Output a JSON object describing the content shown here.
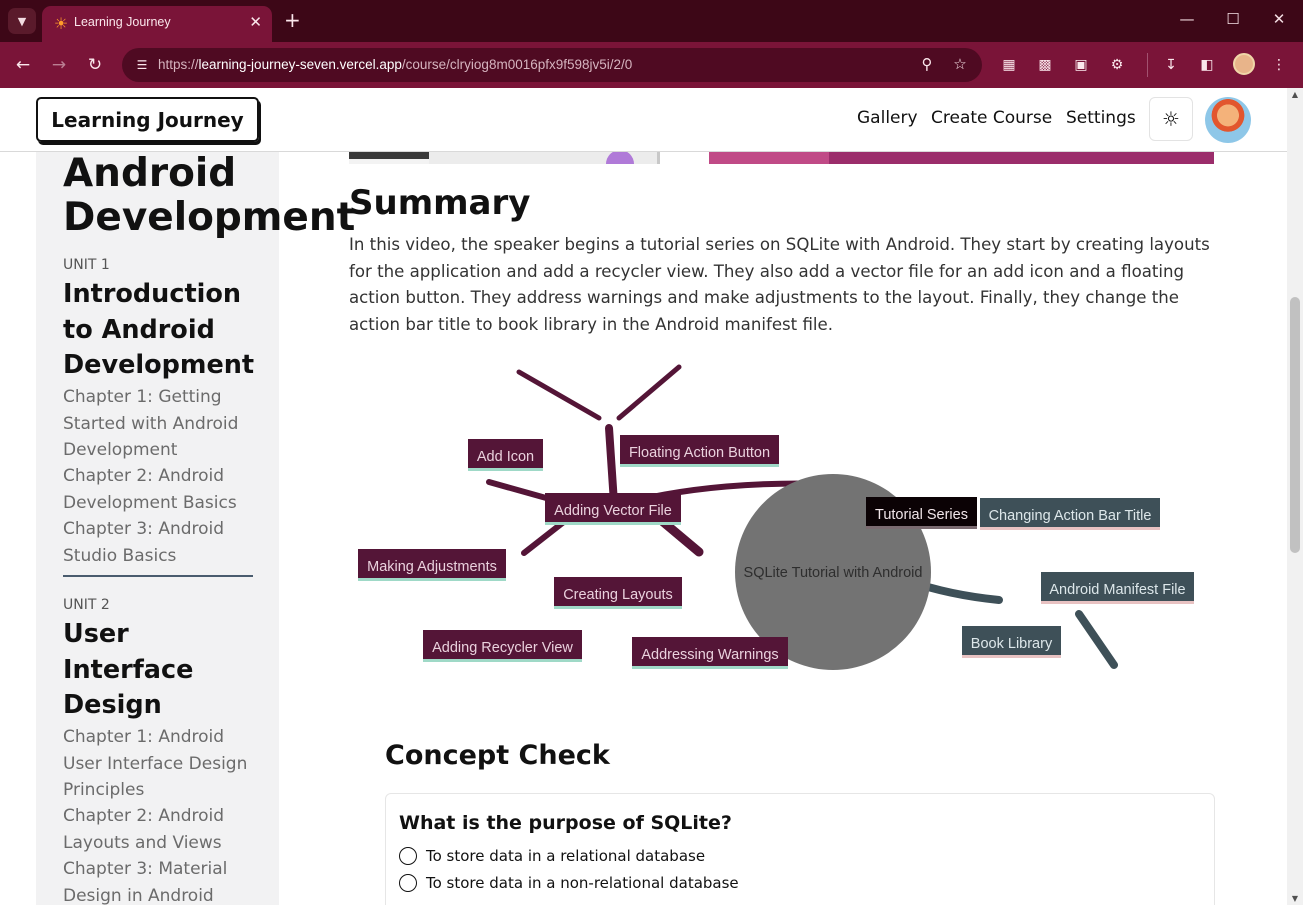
{
  "browser": {
    "tab_title": "Learning Journey",
    "url_scheme": "https://",
    "url_host": "learning-journey-seven.vercel.app",
    "url_path": "/course/clryiog8m0016pfx9f598jv5i/2/0"
  },
  "site": {
    "logo": "Learning Journey",
    "nav": [
      "Gallery",
      "Create Course",
      "Settings"
    ]
  },
  "sidebar": {
    "course_title_line1": "Android",
    "course_title_line2": "Development",
    "units": [
      {
        "label": "UNIT 1",
        "title": "Introduction to Android Development",
        "chapters": [
          "Chapter 1: Getting Started with Android Development",
          "Chapter 2: Android Development Basics",
          "Chapter 3: Android Studio Basics"
        ]
      },
      {
        "label": "UNIT 2",
        "title": "User Interface Design",
        "chapters": [
          "Chapter 1: Android User Interface Design Principles",
          "Chapter 2: Android Layouts and Views",
          "Chapter 3: Material Design in Android"
        ]
      }
    ]
  },
  "summary": {
    "heading": "Summary",
    "text": "In this video, the speaker begins a tutorial series on SQLite with Android. They start by creating layouts for the application and add a recycler view. They also add a vector file for an add icon and a floating action button. They address warnings and make adjustments to the layout. Finally, they change the action bar title to book library in the Android manifest file."
  },
  "mindmap": {
    "root": "SQLite Tutorial with Android",
    "nodes": {
      "add_icon": "Add Icon",
      "fab": "Floating Action Button",
      "vector": "Adding Vector File",
      "tutorial": "Tutorial Series",
      "adjust": "Making Adjustments",
      "layouts": "Creating Layouts",
      "recycler": "Adding Recycler View",
      "warnings": "Addressing Warnings",
      "actionbar": "Changing Action Bar Title",
      "manifest": "Android Manifest File",
      "library": "Book Library"
    },
    "colors": {
      "root": "#737373",
      "left_branch": "#541537",
      "right_branch": "#3e5058",
      "tutorial": "#0b0205"
    }
  },
  "concept_check": {
    "heading": "Concept Check",
    "question": "What is the purpose of SQLite?",
    "options": [
      "To store data in a relational database",
      "To store data in a non-relational database"
    ]
  }
}
